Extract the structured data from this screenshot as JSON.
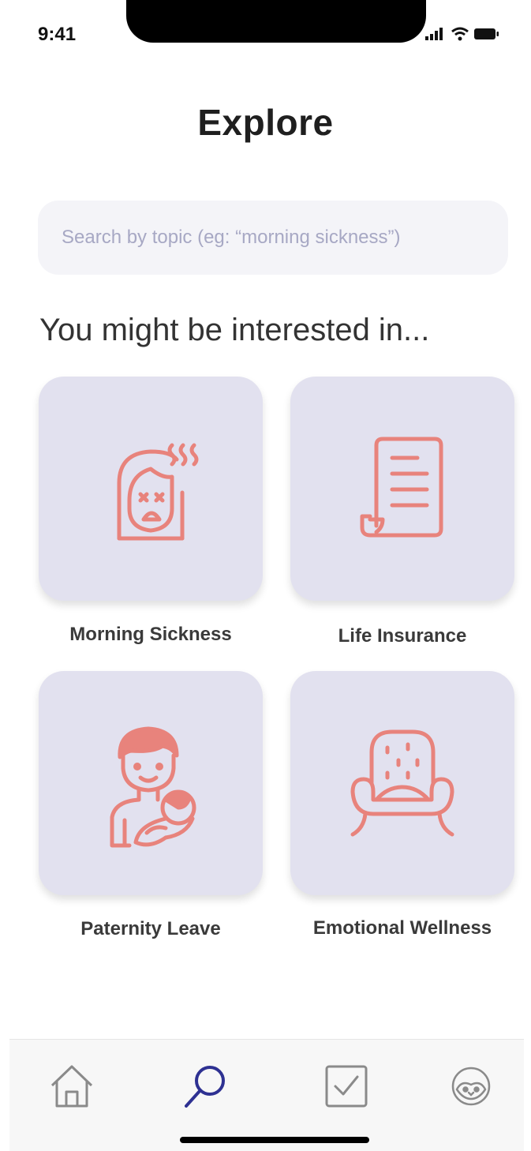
{
  "status_bar": {
    "time": "9:41"
  },
  "header": {
    "title": "Explore"
  },
  "search": {
    "placeholder": "Search by topic (eg: “morning sickness”)"
  },
  "section": {
    "heading": "You might be interested in..."
  },
  "topics": [
    {
      "label": "Morning Sickness",
      "icon": "sick-face-icon"
    },
    {
      "label": "Life Insurance",
      "icon": "document-scroll-icon"
    },
    {
      "label": "Paternity Leave",
      "icon": "father-with-baby-icon"
    },
    {
      "label": "Emotional Wellness",
      "icon": "armchair-icon"
    }
  ],
  "tab_bar": {
    "items": [
      {
        "name": "home",
        "icon": "home-icon",
        "active": false
      },
      {
        "name": "explore",
        "icon": "search-icon",
        "active": true
      },
      {
        "name": "tasks",
        "icon": "checkbox-icon",
        "active": false
      },
      {
        "name": "profile",
        "icon": "penguin-face-icon",
        "active": false
      }
    ]
  },
  "colors": {
    "accent": "#2e3192",
    "icon_coral": "#e8837c",
    "card_background": "#e2e1ef",
    "search_background": "#f4f4f8",
    "tab_icon_inactive": "#8a8a8a"
  }
}
